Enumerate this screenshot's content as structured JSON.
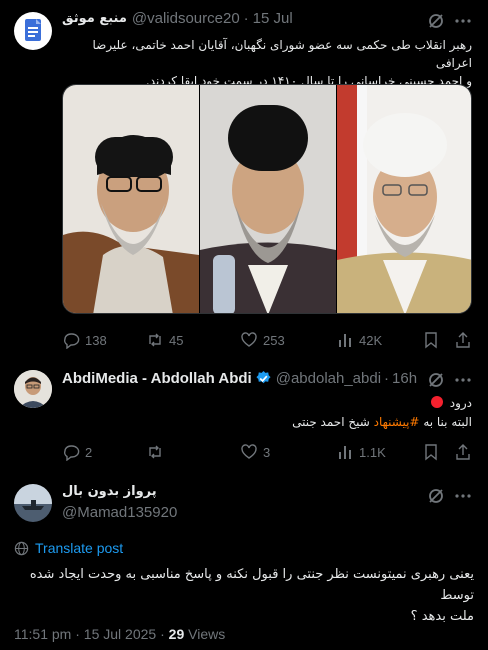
{
  "tweet1": {
    "name": "منبع موثق",
    "handle": "@validsource20",
    "dot": "·",
    "date": "15 Jul",
    "text_line1": "رهبر انقلاب طی حکمی سه عضو شورای نگهبان، آقایان احمد خاتمی، علیرضا اعرافی",
    "text_line2": "و احمد حسینی خراسانی را تا سال ۱۴۱۰ در سمت خود ابقا کردند.",
    "stats": {
      "replies": "138",
      "reposts": "45",
      "likes": "253",
      "views": "42K"
    },
    "colors": {
      "avatar_bg": "#ffffff",
      "doc_icon": "#3b6fd9"
    }
  },
  "tweet2": {
    "name": "AbdiMedia - Abdollah Abdi",
    "handle": "@abdolah_abdi",
    "dot": "·",
    "time": "16h",
    "line1": "درود",
    "line2_prefix": "البته بنا به",
    "hashtag": "#پیشنهاد",
    "line2_suffix": "شیخ احمد جنتی",
    "stats": {
      "replies": "2",
      "reposts": "",
      "likes": "3",
      "views": "1.1K"
    },
    "colors": {
      "verified": "#1d9bf0",
      "hashtag": "#ff7a00",
      "red_dot": "#f4212e"
    }
  },
  "tweet3": {
    "name": "پرواز بدون بال",
    "handle": "@Mamad135920",
    "translate": "Translate post",
    "text_line1": "یعنی رهبری نمیتونست نظر جنتی را قبول نکنه و پاسخ مناسبی به وحدت ایجاد شده توسط",
    "text_line2": "ملت بدهد ؟",
    "time": "11:51 pm",
    "date": "15 Jul 2025",
    "views_count": "29",
    "views_label": "Views",
    "colors": {
      "link": "#1d9bf0"
    }
  },
  "icons": [
    "grok-icon",
    "more-icon",
    "reply-icon",
    "repost-icon",
    "like-icon",
    "views-icon",
    "bookmark-icon",
    "share-icon",
    "globe-icon",
    "verified-icon"
  ]
}
